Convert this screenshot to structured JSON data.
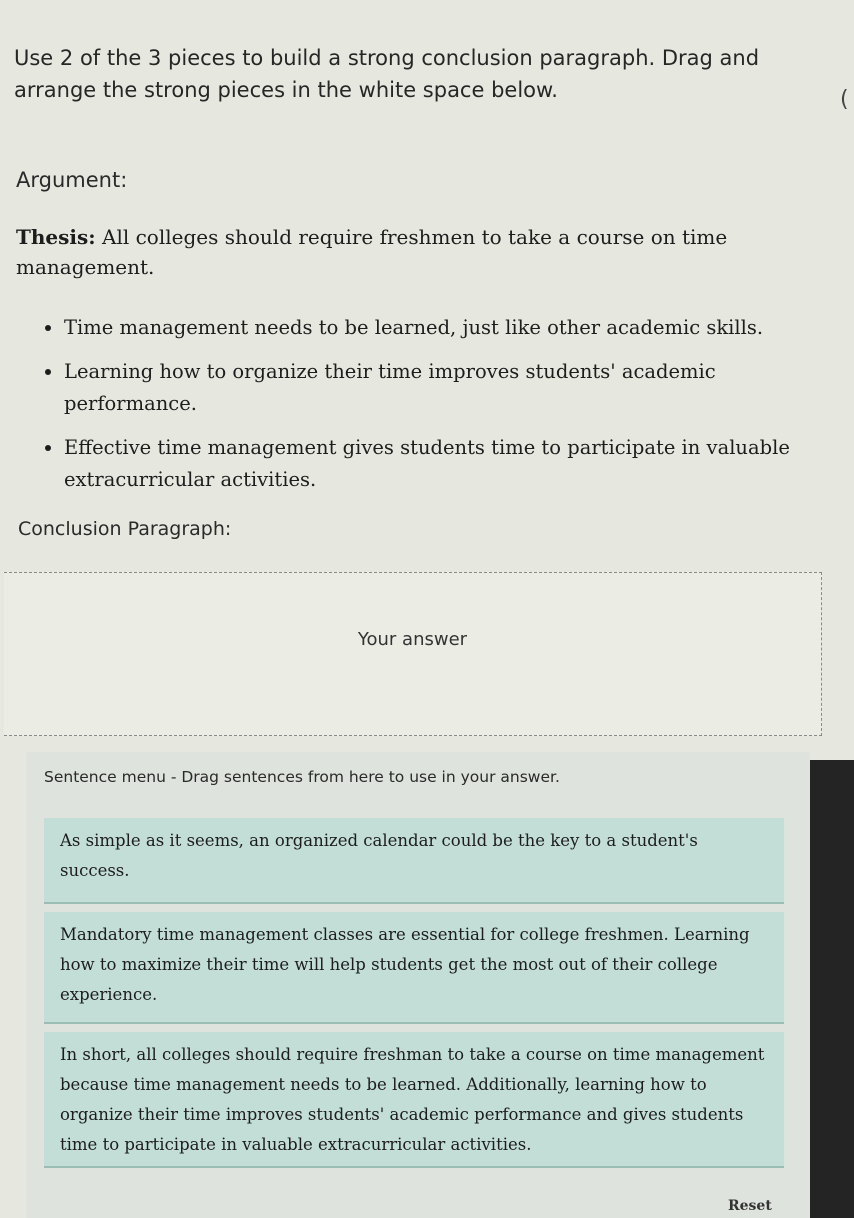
{
  "instructions": "Use 2 of the 3 pieces to build a strong conclusion paragraph. Drag and arrange the strong pieces in the white space below.",
  "argument_heading": "Argument:",
  "thesis": {
    "label": "Thesis:",
    "text": "All colleges should require freshmen to take a course on time management."
  },
  "points": [
    "Time management needs to be learned, just like other academic skills.",
    "Learning how to organize their time improves students' academic performance.",
    "Effective time management gives students time to participate in valuable extracurricular activities."
  ],
  "conclusion_heading": "Conclusion Paragraph:",
  "answer_placeholder": "Your answer",
  "sentence_menu": {
    "label": "Sentence menu - Drag sentences from here to use in your answer.",
    "sentences": [
      "As simple as it seems, an organized calendar could be the key to a student's success.",
      "Mandatory time management classes are essential for college freshmen. Learning how to maximize their time will help students get the most out of their college experience.",
      "In short, all colleges should require freshman to take a course on time management because time management needs to be learned. Additionally, learning how to organize their time improves students' academic performance and gives students time to participate in valuable extracurricular activities."
    ]
  },
  "reset_label": "Reset"
}
